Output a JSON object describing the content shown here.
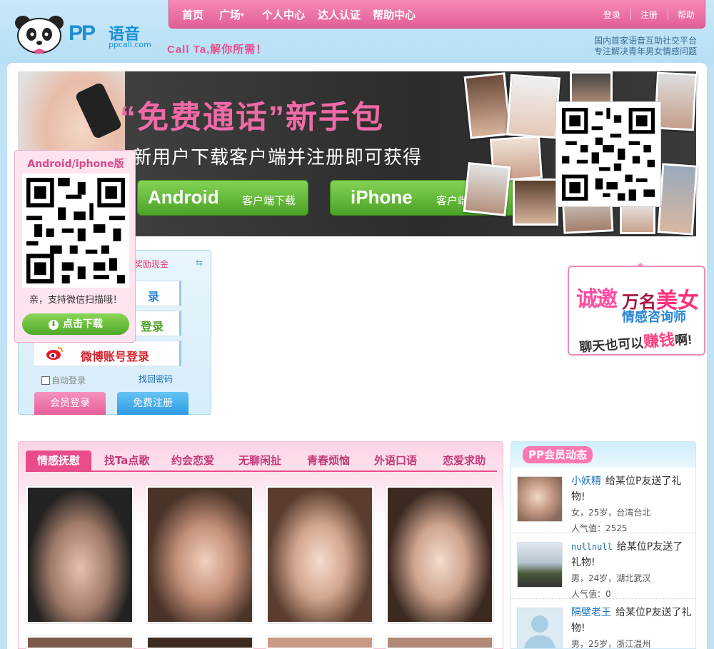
{
  "header": {
    "logo_pp": "PP",
    "logo_cn": "语音",
    "logo_domain": "ppcall.com",
    "slogan": "Call Ta,解你所需！",
    "nav": [
      "首页",
      "广场",
      "个人中心",
      "达人认证",
      "帮助中心"
    ],
    "nav_caret": "▾",
    "right_links": [
      "登录",
      "注册",
      "帮助"
    ],
    "tagline": [
      "国内首家语音互助社交平台",
      "专注解决青年男女情感问题"
    ]
  },
  "banner": {
    "title": "“免费通话”新手包",
    "subtitle": "新用户下载客户端并注册即可获得",
    "android_big": "Android",
    "android_small": "客户端下载",
    "iphone_big": "iPhone",
    "iphone_small": "客户端下载"
  },
  "qr_popup": {
    "title": "Android/iphone版",
    "text": "亲，支持微信扫描哦！",
    "button": "点击下载",
    "button_icon": "⬇"
  },
  "login": {
    "top_text": "奖励现金",
    "arrow": "⇆",
    "btn1": "录",
    "btn2": "登录",
    "weibo": "微博账号登录",
    "remember": "自动登录",
    "find_password": "找回密码",
    "member_login": "会员登录",
    "free_register": "免费注册"
  },
  "invite": {
    "a": "诚邀",
    "b_pre": "万名",
    "b_mei": "美女",
    "c": "情感咨询师",
    "d_pre": "聊天也可以",
    "d_earn": "赚钱",
    "d_post": "啊!"
  },
  "category": {
    "tabs": [
      "情感抚慰",
      "找Ta点歌",
      "约会恋爱",
      "无聊闲扯",
      "青春烦恼",
      "外语口语",
      "恋爱求助"
    ]
  },
  "news": {
    "title": "PP会员动态",
    "items": [
      {
        "name": "小妖精",
        "action": "给某位P友送了礼物!",
        "info": "女，25岁，台湾台北",
        "popularity": "人气值：2525"
      },
      {
        "name": "nullnull",
        "action": "给某位P友送了礼物!",
        "info": "男，24岁，湖北武汉",
        "popularity": "人气值：0"
      },
      {
        "name": "隔壁老王",
        "action": "给某位P友送了礼物!",
        "info": "男，25岁，浙江温州",
        "popularity": ""
      }
    ]
  },
  "colors": {
    "pink": "#e35e97",
    "blue": "#1a8fd6",
    "green": "#4ba325"
  }
}
